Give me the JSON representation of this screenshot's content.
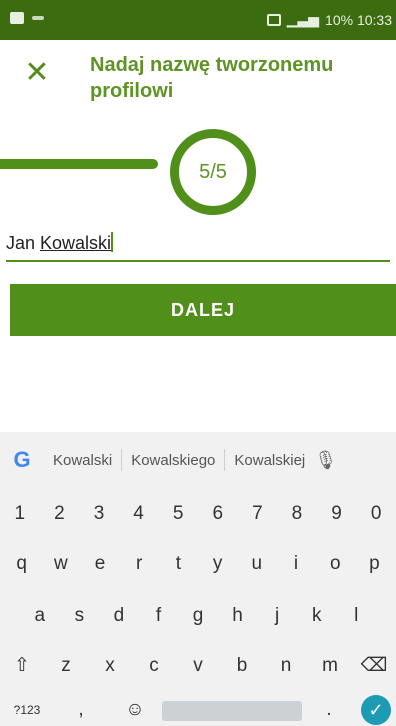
{
  "status_bar": {
    "right_text": "10% 10:33"
  },
  "header": {
    "close_icon": "close-icon",
    "title": "Nadaj nazwę tworzonemu profilowi"
  },
  "progress": {
    "step_label": "5/5",
    "fraction": 1.0
  },
  "name_input": {
    "value_first": "Jan ",
    "value_underlined": "Kowalski"
  },
  "actions": {
    "next_label": "DALEJ"
  },
  "keyboard": {
    "google_logo": "G",
    "suggestions": [
      "Kowalski",
      "Kowalskiego",
      "Kowalskiej"
    ],
    "row1": [
      "1",
      "2",
      "3",
      "4",
      "5",
      "6",
      "7",
      "8",
      "9",
      "0"
    ],
    "row2": [
      "q",
      "w",
      "e",
      "r",
      "t",
      "y",
      "u",
      "i",
      "o",
      "p"
    ],
    "row3": [
      "a",
      "s",
      "d",
      "f",
      "g",
      "h",
      "j",
      "k",
      "l"
    ],
    "row4": [
      "⇧",
      "z",
      "x",
      "c",
      "v",
      "b",
      "n",
      "m",
      "⌫"
    ],
    "row5_left": [
      "?123",
      ",",
      "☺"
    ],
    "row5_right": [
      "."
    ],
    "enter_symbol": "✓"
  },
  "colors": {
    "accent": "#4f8f1a",
    "status_bar": "#3d6b0f",
    "enter": "#1d9bb5"
  }
}
